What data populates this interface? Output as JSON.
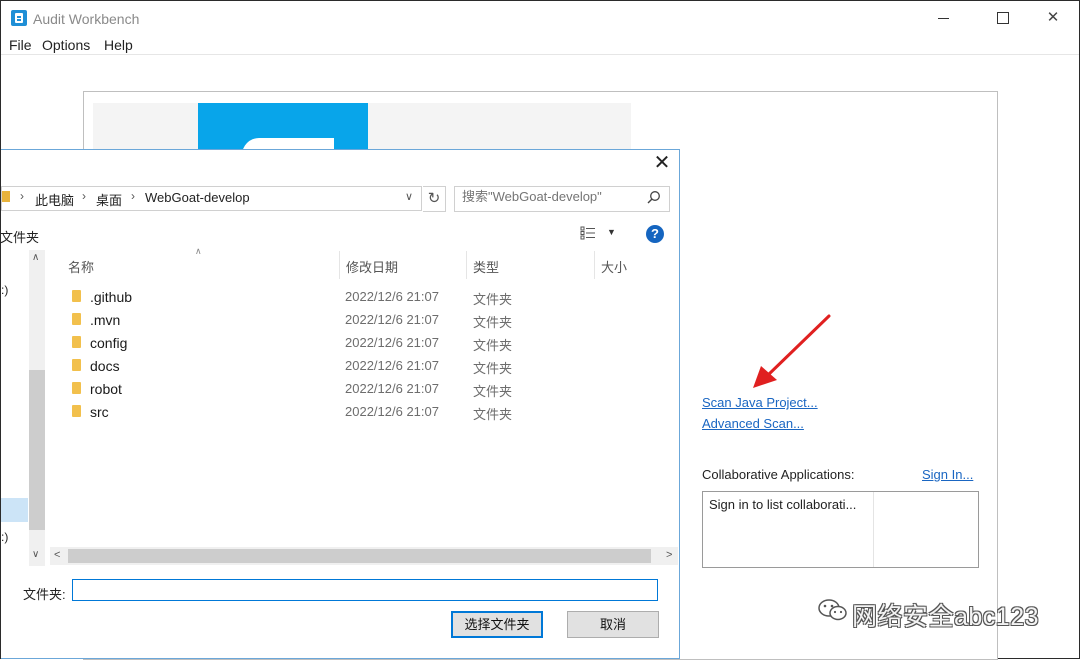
{
  "window": {
    "title": "Audit Workbench"
  },
  "menu": [
    "File",
    "Options",
    "Help"
  ],
  "welcome": {
    "scan_java": "Scan Java Project...",
    "advanced_scan": "Advanced Scan...",
    "collab_label": "Collaborative Applications:",
    "sign_in": "Sign In...",
    "collab_placeholder": "Sign in to list collaborati..."
  },
  "dialog": {
    "breadcrumb": [
      "此电脑",
      "桌面",
      "WebGoat-develop"
    ],
    "search_placeholder": "搜索\"WebGoat-develop\"",
    "new_folder": "文件夹",
    "nav_items": [
      ":)",
      ":)"
    ],
    "columns": {
      "name": "名称",
      "date": "修改日期",
      "type": "类型",
      "size": "大小"
    },
    "files": [
      {
        "name": ".github",
        "date": "2022/12/6 21:07",
        "type": "文件夹"
      },
      {
        "name": ".mvn",
        "date": "2022/12/6 21:07",
        "type": "文件夹"
      },
      {
        "name": "config",
        "date": "2022/12/6 21:07",
        "type": "文件夹"
      },
      {
        "name": "docs",
        "date": "2022/12/6 21:07",
        "type": "文件夹"
      },
      {
        "name": "robot",
        "date": "2022/12/6 21:07",
        "type": "文件夹"
      },
      {
        "name": "src",
        "date": "2022/12/6 21:07",
        "type": "文件夹"
      }
    ],
    "folder_label": "文件夹:",
    "folder_value": "",
    "select_button": "选择文件夹",
    "cancel_button": "取消"
  },
  "watermark": {
    "text": "网络安全abc123"
  },
  "colors": {
    "accent": "#0078d7",
    "link": "#1a66c2",
    "arrow": "#e02020",
    "logo": "#08a5ea"
  }
}
